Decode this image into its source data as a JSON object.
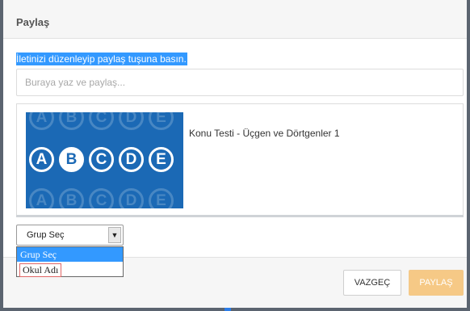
{
  "dialog": {
    "title": "Paylaş",
    "instruction": "İletinizi düzenleyip paylaş tuşuna basın.",
    "input_placeholder": "Buraya yaz ve paylaş..."
  },
  "attachment": {
    "thumbnail_letters": [
      "A",
      "B",
      "C",
      "D",
      "E"
    ],
    "title": "Konu Testi - Üçgen ve Dörtgenler 1"
  },
  "group_select": {
    "selected": "Grup Seç",
    "options": [
      "Grup Seç",
      "Okul Adı"
    ]
  },
  "footer": {
    "cancel_label": "VAZGEÇ",
    "share_label": "PAYLAŞ"
  },
  "colors": {
    "accent": "#3399ff",
    "thumbnail_bg": "#1b69b5",
    "share_button": "#f6c986"
  }
}
